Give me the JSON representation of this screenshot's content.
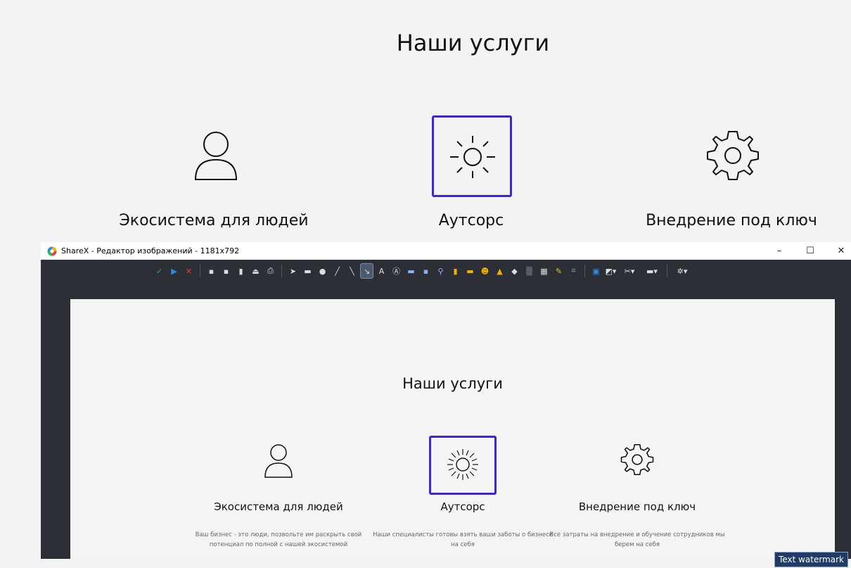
{
  "page": {
    "title": "Наши услуги",
    "services": [
      {
        "label": "Экосистема для людей"
      },
      {
        "label": "Аутсорс"
      },
      {
        "label": "Внедрение под ключ"
      }
    ]
  },
  "window": {
    "title": "ShareX - Редактор изображений - 1181x792",
    "controls": {
      "minimize": "–",
      "maximize": "☐",
      "close": "✕"
    }
  },
  "canvas": {
    "title": "Наши услуги",
    "services": [
      {
        "label": "Экосистема для людей",
        "desc": "Ваш бизнес - это люди, позвольте им раскрыть свой потенциал по полной с нашей экосистемой"
      },
      {
        "label": "Аутсорс",
        "desc": "Наши специалисты готовы взять ваши заботы о бизнесе на себя"
      },
      {
        "label": "Внедрение под ключ",
        "desc": "Все затраты на внедрение и обучение сотрудников мы берем на себя"
      }
    ]
  },
  "watermark": "Text watermark",
  "colors": {
    "accent": "#3a26d8",
    "editor_bg": "#2c2f36"
  }
}
